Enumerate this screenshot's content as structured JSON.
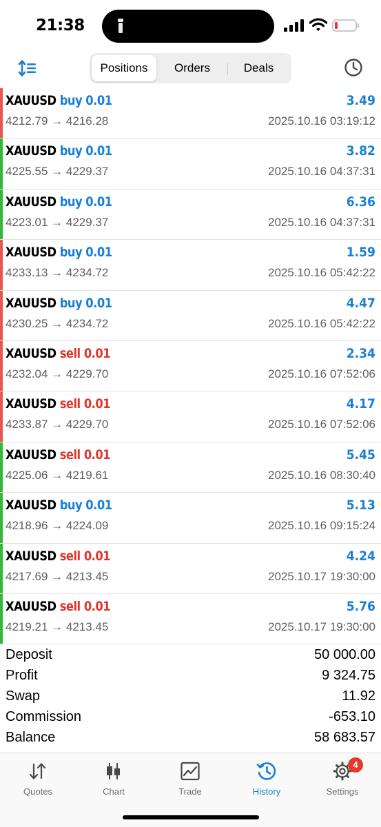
{
  "status_bar": {
    "time": "21:38"
  },
  "toolbar": {
    "tabs": [
      {
        "label": "Positions",
        "active": true
      },
      {
        "label": "Orders",
        "active": false
      },
      {
        "label": "Deals",
        "active": false
      }
    ]
  },
  "colors": {
    "buy": "#1a7fd4",
    "sell": "#e0352b",
    "profit": "#1a7fd4",
    "bar_red": "#e8574f",
    "bar_green": "#34b83a",
    "accent": "#1a7fd4"
  },
  "deals": [
    {
      "symbol": "XAUUSD",
      "side": "buy",
      "volume": "0.01",
      "profit": "3.49",
      "prices": "4212.79 → 4216.28",
      "time": "2025.10.16 03:19:12",
      "bar": "red"
    },
    {
      "symbol": "XAUUSD",
      "side": "buy",
      "volume": "0.01",
      "profit": "3.82",
      "prices": "4225.55 → 4229.37",
      "time": "2025.10.16 04:37:31",
      "bar": "green"
    },
    {
      "symbol": "XAUUSD",
      "side": "buy",
      "volume": "0.01",
      "profit": "6.36",
      "prices": "4223.01 → 4229.37",
      "time": "2025.10.16 04:37:31",
      "bar": "green"
    },
    {
      "symbol": "XAUUSD",
      "side": "buy",
      "volume": "0.01",
      "profit": "1.59",
      "prices": "4233.13 → 4234.72",
      "time": "2025.10.16 05:42:22",
      "bar": "red"
    },
    {
      "symbol": "XAUUSD",
      "side": "buy",
      "volume": "0.01",
      "profit": "4.47",
      "prices": "4230.25 → 4234.72",
      "time": "2025.10.16 05:42:22",
      "bar": "red"
    },
    {
      "symbol": "XAUUSD",
      "side": "sell",
      "volume": "0.01",
      "profit": "2.34",
      "prices": "4232.04 → 4229.70",
      "time": "2025.10.16 07:52:06",
      "bar": "red"
    },
    {
      "symbol": "XAUUSD",
      "side": "sell",
      "volume": "0.01",
      "profit": "4.17",
      "prices": "4233.87 → 4229.70",
      "time": "2025.10.16 07:52:06",
      "bar": "red"
    },
    {
      "symbol": "XAUUSD",
      "side": "sell",
      "volume": "0.01",
      "profit": "5.45",
      "prices": "4225.06 → 4219.61",
      "time": "2025.10.16 08:30:40",
      "bar": "green"
    },
    {
      "symbol": "XAUUSD",
      "side": "buy",
      "volume": "0.01",
      "profit": "5.13",
      "prices": "4218.96 → 4224.09",
      "time": "2025.10.16 09:15:24",
      "bar": "green"
    },
    {
      "symbol": "XAUUSD",
      "side": "sell",
      "volume": "0.01",
      "profit": "4.24",
      "prices": "4217.69 → 4213.45",
      "time": "2025.10.17 19:30:00",
      "bar": "green"
    },
    {
      "symbol": "XAUUSD",
      "side": "sell",
      "volume": "0.01",
      "profit": "5.76",
      "prices": "4219.21 → 4213.45",
      "time": "2025.10.17 19:30:00",
      "bar": "green"
    }
  ],
  "summary": [
    {
      "label": "Deposit",
      "value": "50 000.00"
    },
    {
      "label": "Profit",
      "value": "9 324.75"
    },
    {
      "label": "Swap",
      "value": "11.92"
    },
    {
      "label": "Commission",
      "value": "-653.10"
    },
    {
      "label": "Balance",
      "value": "58 683.57"
    }
  ],
  "tabbar": {
    "tabs": [
      {
        "label": "Quotes",
        "icon": "quotes-arrows-icon",
        "active": false
      },
      {
        "label": "Chart",
        "icon": "candlestick-icon",
        "active": false
      },
      {
        "label": "Trade",
        "icon": "trade-chart-icon",
        "active": false
      },
      {
        "label": "History",
        "icon": "history-clock-icon",
        "active": true
      },
      {
        "label": "Settings",
        "icon": "gear-icon",
        "active": false,
        "badge": "4"
      }
    ]
  }
}
